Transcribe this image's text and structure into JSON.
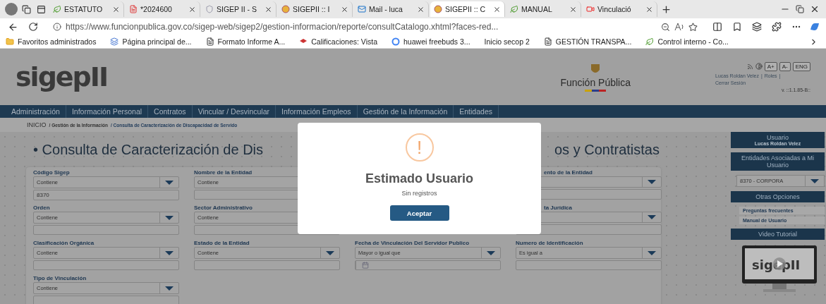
{
  "browser": {
    "tabs": [
      {
        "title": "ESTATUTO",
        "selected": false
      },
      {
        "title": "*2024600",
        "selected": false
      },
      {
        "title": "SIGEP II - S",
        "selected": false
      },
      {
        "title": "SIGEPII :: I",
        "selected": false
      },
      {
        "title": "Mail - luca",
        "selected": false
      },
      {
        "title": "SIGEPII :: C",
        "selected": true
      },
      {
        "title": "MANUAL",
        "selected": false
      },
      {
        "title": "Vinculació",
        "selected": false
      }
    ],
    "url": "https://www.funcionpublica.gov.co/sigep-web/sigep2/gestion-informacion/reporte/consultCatalogo.xhtml?faces-red...",
    "bookmarks": [
      "Favoritos administrados",
      "Página principal de...",
      "Formato Informe A...",
      "Calificaciones: Vista",
      "huawei freebuds 3...",
      "Inicio secop 2",
      "GESTIÓN TRANSPA...",
      "Control interno - Co..."
    ]
  },
  "header": {
    "logo": "sigepII",
    "brand": "Función Pública",
    "tools": [
      "A+",
      "A-",
      "ENG"
    ],
    "user_links": [
      "Lucas Roldan Velez",
      "Roles",
      "Cerrar Sesión"
    ],
    "separators": [
      "|",
      "|"
    ],
    "version": "v. ::1.1.85-B::"
  },
  "nav": [
    "Administración",
    "Información Personal",
    "Contratos",
    "Vincular / Desvincular",
    "Información Empleos",
    "Gestión de la Información",
    "Entidades"
  ],
  "breadcrumb": [
    "INICIO",
    "/ Gestión de la Información",
    "/ Consulta de Caracterización de Discapacidad de Servido"
  ],
  "title": {
    "left": "• Consulta de Caracterización de Dis",
    "right": "os y Contratistas"
  },
  "form": [
    {
      "kind": "select",
      "label": "Código Sigep",
      "operator": "Contiene",
      "input": "8370"
    },
    {
      "kind": "select",
      "label": "Nombre de la Entidad",
      "operator": "Contiene"
    },
    {
      "kind": "covered"
    },
    {
      "kind": "partial",
      "label": "ento de la Entidad"
    },
    {
      "kind": "select",
      "label": "Orden",
      "operator": "Contiene"
    },
    {
      "kind": "select",
      "label": "Sector Administrativo",
      "operator": "Contiene"
    },
    {
      "kind": "covered"
    },
    {
      "kind": "partial",
      "label": "ta Jurídica"
    },
    {
      "kind": "select",
      "label": "Clasificación Orgánica",
      "operator": "Contiene"
    },
    {
      "kind": "select",
      "label": "Estado de la Entidad",
      "operator": "Contiene"
    },
    {
      "kind": "date",
      "label": "Fecha de Vinculación Del Servidor Publico",
      "operator": "Mayor o igual que"
    },
    {
      "kind": "select",
      "label": "Numero de Identificación",
      "operator": "Es igual a"
    },
    {
      "kind": "select",
      "label": "Tipo de Vinculación",
      "operator": "Contiene"
    }
  ],
  "sidebar": {
    "user_heading": "Usuario",
    "user_name": "Lucas Roldan Velez",
    "entities_heading": "Entidades Asociadas a Mi Usuario",
    "entity": "8370 - CORPORA",
    "options_heading": "Otras Opciones",
    "links": [
      "Preguntas frecuentes",
      "Manual de Usuario"
    ],
    "video_heading": "Video Tutorial",
    "video_logo": "sigepII"
  },
  "dialog": {
    "icon": "!",
    "title": "Estimado Usuario",
    "message": "Sin registros",
    "button": "Aceptar"
  }
}
